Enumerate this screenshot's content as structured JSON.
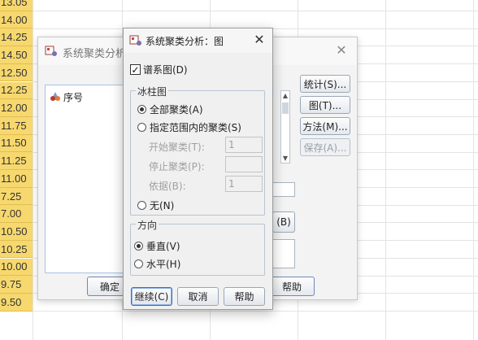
{
  "sheet": {
    "rows": [
      "13.05",
      "14.00",
      "14.25",
      "14.50",
      "12.50",
      "12.25",
      "12.00",
      "11.75",
      "11.50",
      "11.25",
      "11.00",
      "7.25",
      "7.00",
      "10.50",
      "10.25",
      "10.00",
      "9.75",
      "9.50"
    ]
  },
  "parent": {
    "title": "系统聚类分析",
    "variable": "序号",
    "buttons": {
      "stats": "统计(S)...",
      "plots": "图(T)...",
      "method": "方法(M)...",
      "save": "保存(A)..."
    },
    "fragment_b": "(B)",
    "bottom": {
      "ok": "确定",
      "help": "帮助"
    }
  },
  "dialog": {
    "title": "系统聚类分析：图",
    "dendrogram_label": "谱系图(D)",
    "dendrogram_checked": true,
    "icicle": {
      "legend": "冰柱图",
      "all_clusters": "全部聚类(A)",
      "range_clusters": "指定范围内的聚类(S)",
      "start_label": "开始聚类(T):",
      "start_value": "1",
      "stop_label": "停止聚类(P):",
      "stop_value": "",
      "by_label": "依据(B):",
      "by_value": "1",
      "none": "无(N)",
      "selected": "all_clusters"
    },
    "orientation": {
      "legend": "方向",
      "vertical": "垂直(V)",
      "horizontal": "水平(H)",
      "selected": "vertical"
    },
    "buttons": {
      "continue": "继续(C)",
      "cancel": "取消",
      "help": "帮助"
    }
  },
  "colors": {
    "row_header": "#f7d86e",
    "accent_border": "#3c6fb8"
  },
  "icons": {
    "app": "spss-dialog-icon",
    "close": "close-icon",
    "variable": "scale-variable-icon"
  }
}
